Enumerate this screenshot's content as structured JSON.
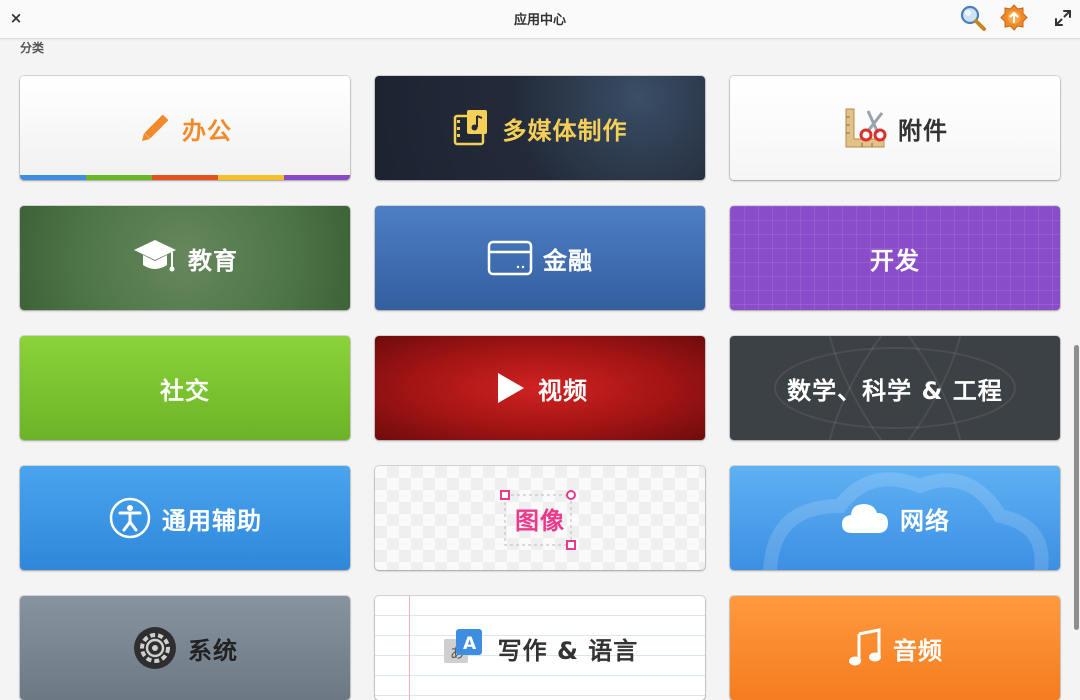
{
  "header": {
    "title": "应用中心",
    "close_label": "×"
  },
  "section_label": "分类",
  "colors": {
    "office_stripe": [
      "#3d8ee0",
      "#68b723",
      "#e0511f",
      "#f3c127",
      "#8a48c6"
    ]
  },
  "categories": [
    {
      "label": "办公",
      "icon": "pencil-icon"
    },
    {
      "label": "多媒体制作",
      "icon": "film-music-icon"
    },
    {
      "label": "附件",
      "icon": "ruler-scissors-icon"
    },
    {
      "label": "教育",
      "icon": "graduation-cap-icon"
    },
    {
      "label": "金融",
      "icon": "card-icon"
    },
    {
      "label": "开发",
      "icon": ""
    },
    {
      "label": "社交",
      "icon": ""
    },
    {
      "label": "视频",
      "icon": "play-icon"
    },
    {
      "label": "数学、科学 & 工程",
      "icon": ""
    },
    {
      "label": "通用辅助",
      "icon": "accessibility-icon"
    },
    {
      "label": "图像",
      "icon": "selection-frame-icon"
    },
    {
      "label": "网络",
      "icon": "cloud-icon"
    },
    {
      "label": "系统",
      "icon": "gear-icon"
    },
    {
      "label": "写作 & 语言",
      "icon": "language-icon"
    },
    {
      "label": "音频",
      "icon": "music-note-icon"
    }
  ]
}
